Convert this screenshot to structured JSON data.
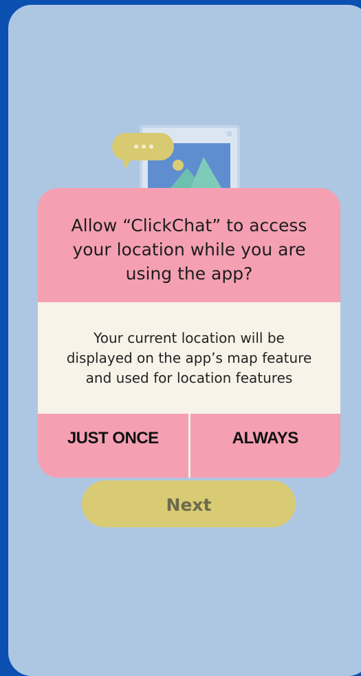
{
  "dialog": {
    "title": "Allow “ClickChat” to access your location while you are using the app?",
    "message": "Your current location will be displayed on the app’s map feature and used for location features",
    "button_once": "JUST ONCE",
    "button_always": "ALWAYS"
  },
  "next_label": "Next",
  "illustration": {
    "bubble_icon": "chat-bubble-icon",
    "image_icon": "image-card-icon"
  },
  "colors": {
    "background": "#0b4fb0",
    "screen": "#adc6e2",
    "dialog_pink": "#f4a0b2",
    "dialog_body": "#f7f3e9",
    "next_button": "#d8cb74"
  }
}
